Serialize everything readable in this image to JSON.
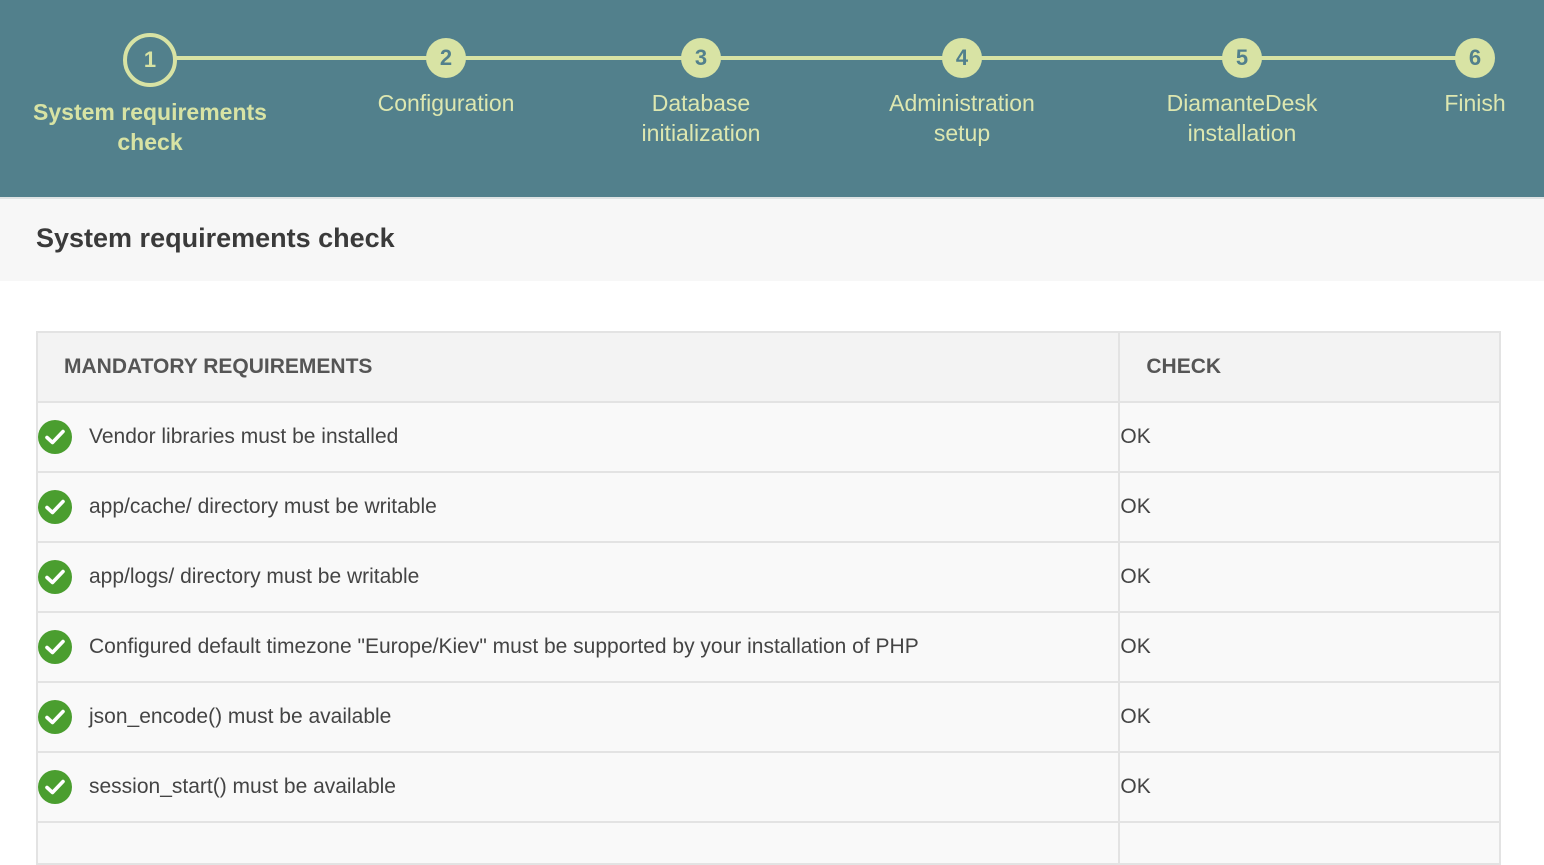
{
  "wizard": {
    "steps": [
      {
        "number": "1",
        "label": "System requirements check",
        "active": true
      },
      {
        "number": "2",
        "label": "Configuration"
      },
      {
        "number": "3",
        "label": "Database initialization"
      },
      {
        "number": "4",
        "label": "Administration setup"
      },
      {
        "number": "5",
        "label": "DiamanteDesk installation"
      },
      {
        "number": "6",
        "label": "Finish"
      }
    ]
  },
  "page": {
    "title": "System requirements check"
  },
  "table": {
    "headers": {
      "requirement": "MANDATORY REQUIREMENTS",
      "check": "CHECK"
    },
    "rows": [
      {
        "icon": "check-circle-icon",
        "requirement": "Vendor libraries must be installed",
        "status": "OK"
      },
      {
        "icon": "check-circle-icon",
        "requirement": "app/cache/ directory must be writable",
        "status": "OK"
      },
      {
        "icon": "check-circle-icon",
        "requirement": "app/logs/ directory must be writable",
        "status": "OK"
      },
      {
        "icon": "check-circle-icon",
        "requirement": "Configured default timezone \"Europe/Kiev\" must be supported by your installation of PHP",
        "status": "OK"
      },
      {
        "icon": "check-circle-icon",
        "requirement": "json_encode() must be available",
        "status": "OK"
      },
      {
        "icon": "check-circle-icon",
        "requirement": "session_start() must be available",
        "status": "OK"
      }
    ]
  },
  "colors": {
    "header_bg": "#52808c",
    "accent": "#d8e3a4",
    "success": "#4a9e2f"
  }
}
